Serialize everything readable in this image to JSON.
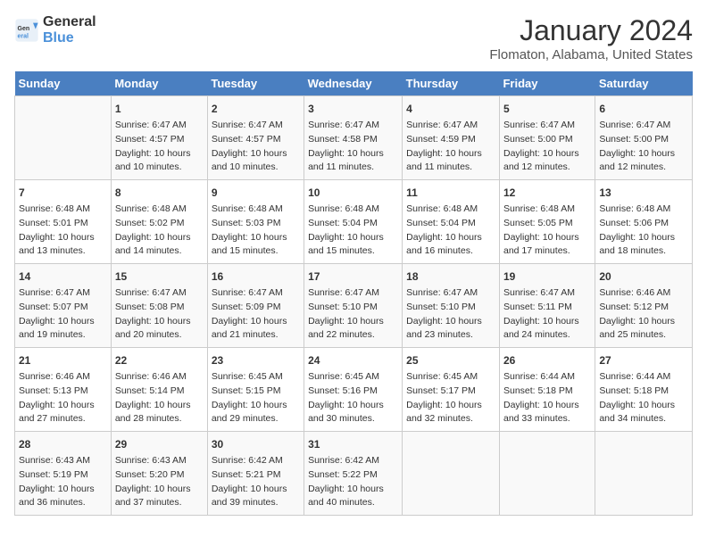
{
  "logo": {
    "line1": "General",
    "line2": "Blue"
  },
  "title": "January 2024",
  "subtitle": "Flomaton, Alabama, United States",
  "headers": [
    "Sunday",
    "Monday",
    "Tuesday",
    "Wednesday",
    "Thursday",
    "Friday",
    "Saturday"
  ],
  "weeks": [
    [
      {
        "day": "",
        "lines": []
      },
      {
        "day": "1",
        "lines": [
          "Sunrise: 6:47 AM",
          "Sunset: 4:57 PM",
          "Daylight: 10 hours",
          "and 10 minutes."
        ]
      },
      {
        "day": "2",
        "lines": [
          "Sunrise: 6:47 AM",
          "Sunset: 4:57 PM",
          "Daylight: 10 hours",
          "and 10 minutes."
        ]
      },
      {
        "day": "3",
        "lines": [
          "Sunrise: 6:47 AM",
          "Sunset: 4:58 PM",
          "Daylight: 10 hours",
          "and 11 minutes."
        ]
      },
      {
        "day": "4",
        "lines": [
          "Sunrise: 6:47 AM",
          "Sunset: 4:59 PM",
          "Daylight: 10 hours",
          "and 11 minutes."
        ]
      },
      {
        "day": "5",
        "lines": [
          "Sunrise: 6:47 AM",
          "Sunset: 5:00 PM",
          "Daylight: 10 hours",
          "and 12 minutes."
        ]
      },
      {
        "day": "6",
        "lines": [
          "Sunrise: 6:47 AM",
          "Sunset: 5:00 PM",
          "Daylight: 10 hours",
          "and 12 minutes."
        ]
      }
    ],
    [
      {
        "day": "7",
        "lines": [
          "Sunrise: 6:48 AM",
          "Sunset: 5:01 PM",
          "Daylight: 10 hours",
          "and 13 minutes."
        ]
      },
      {
        "day": "8",
        "lines": [
          "Sunrise: 6:48 AM",
          "Sunset: 5:02 PM",
          "Daylight: 10 hours",
          "and 14 minutes."
        ]
      },
      {
        "day": "9",
        "lines": [
          "Sunrise: 6:48 AM",
          "Sunset: 5:03 PM",
          "Daylight: 10 hours",
          "and 15 minutes."
        ]
      },
      {
        "day": "10",
        "lines": [
          "Sunrise: 6:48 AM",
          "Sunset: 5:04 PM",
          "Daylight: 10 hours",
          "and 15 minutes."
        ]
      },
      {
        "day": "11",
        "lines": [
          "Sunrise: 6:48 AM",
          "Sunset: 5:04 PM",
          "Daylight: 10 hours",
          "and 16 minutes."
        ]
      },
      {
        "day": "12",
        "lines": [
          "Sunrise: 6:48 AM",
          "Sunset: 5:05 PM",
          "Daylight: 10 hours",
          "and 17 minutes."
        ]
      },
      {
        "day": "13",
        "lines": [
          "Sunrise: 6:48 AM",
          "Sunset: 5:06 PM",
          "Daylight: 10 hours",
          "and 18 minutes."
        ]
      }
    ],
    [
      {
        "day": "14",
        "lines": [
          "Sunrise: 6:47 AM",
          "Sunset: 5:07 PM",
          "Daylight: 10 hours",
          "and 19 minutes."
        ]
      },
      {
        "day": "15",
        "lines": [
          "Sunrise: 6:47 AM",
          "Sunset: 5:08 PM",
          "Daylight: 10 hours",
          "and 20 minutes."
        ]
      },
      {
        "day": "16",
        "lines": [
          "Sunrise: 6:47 AM",
          "Sunset: 5:09 PM",
          "Daylight: 10 hours",
          "and 21 minutes."
        ]
      },
      {
        "day": "17",
        "lines": [
          "Sunrise: 6:47 AM",
          "Sunset: 5:10 PM",
          "Daylight: 10 hours",
          "and 22 minutes."
        ]
      },
      {
        "day": "18",
        "lines": [
          "Sunrise: 6:47 AM",
          "Sunset: 5:10 PM",
          "Daylight: 10 hours",
          "and 23 minutes."
        ]
      },
      {
        "day": "19",
        "lines": [
          "Sunrise: 6:47 AM",
          "Sunset: 5:11 PM",
          "Daylight: 10 hours",
          "and 24 minutes."
        ]
      },
      {
        "day": "20",
        "lines": [
          "Sunrise: 6:46 AM",
          "Sunset: 5:12 PM",
          "Daylight: 10 hours",
          "and 25 minutes."
        ]
      }
    ],
    [
      {
        "day": "21",
        "lines": [
          "Sunrise: 6:46 AM",
          "Sunset: 5:13 PM",
          "Daylight: 10 hours",
          "and 27 minutes."
        ]
      },
      {
        "day": "22",
        "lines": [
          "Sunrise: 6:46 AM",
          "Sunset: 5:14 PM",
          "Daylight: 10 hours",
          "and 28 minutes."
        ]
      },
      {
        "day": "23",
        "lines": [
          "Sunrise: 6:45 AM",
          "Sunset: 5:15 PM",
          "Daylight: 10 hours",
          "and 29 minutes."
        ]
      },
      {
        "day": "24",
        "lines": [
          "Sunrise: 6:45 AM",
          "Sunset: 5:16 PM",
          "Daylight: 10 hours",
          "and 30 minutes."
        ]
      },
      {
        "day": "25",
        "lines": [
          "Sunrise: 6:45 AM",
          "Sunset: 5:17 PM",
          "Daylight: 10 hours",
          "and 32 minutes."
        ]
      },
      {
        "day": "26",
        "lines": [
          "Sunrise: 6:44 AM",
          "Sunset: 5:18 PM",
          "Daylight: 10 hours",
          "and 33 minutes."
        ]
      },
      {
        "day": "27",
        "lines": [
          "Sunrise: 6:44 AM",
          "Sunset: 5:18 PM",
          "Daylight: 10 hours",
          "and 34 minutes."
        ]
      }
    ],
    [
      {
        "day": "28",
        "lines": [
          "Sunrise: 6:43 AM",
          "Sunset: 5:19 PM",
          "Daylight: 10 hours",
          "and 36 minutes."
        ]
      },
      {
        "day": "29",
        "lines": [
          "Sunrise: 6:43 AM",
          "Sunset: 5:20 PM",
          "Daylight: 10 hours",
          "and 37 minutes."
        ]
      },
      {
        "day": "30",
        "lines": [
          "Sunrise: 6:42 AM",
          "Sunset: 5:21 PM",
          "Daylight: 10 hours",
          "and 39 minutes."
        ]
      },
      {
        "day": "31",
        "lines": [
          "Sunrise: 6:42 AM",
          "Sunset: 5:22 PM",
          "Daylight: 10 hours",
          "and 40 minutes."
        ]
      },
      {
        "day": "",
        "lines": []
      },
      {
        "day": "",
        "lines": []
      },
      {
        "day": "",
        "lines": []
      }
    ]
  ]
}
